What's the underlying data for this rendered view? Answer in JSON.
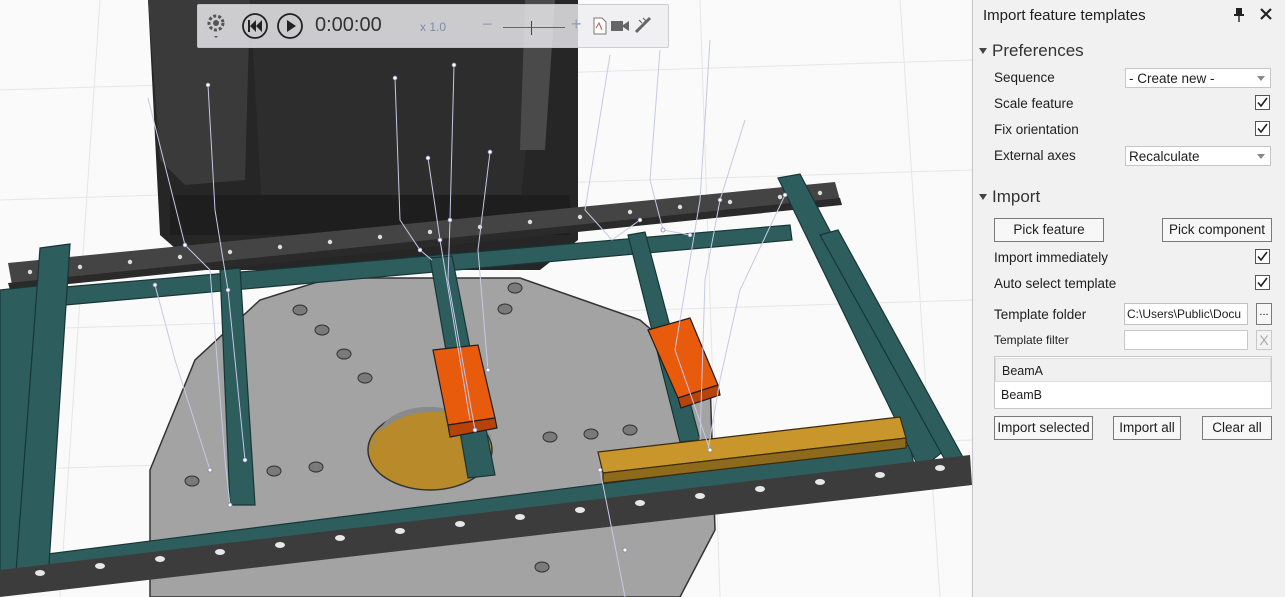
{
  "playback": {
    "time": "0:00:00",
    "speed": "x 1.0",
    "minus": "−",
    "plus": "+"
  },
  "panel": {
    "title": "Import feature templates",
    "preferences": {
      "label": "Preferences",
      "sequence_label": "Sequence",
      "sequence_value": "- Create new -",
      "scale_label": "Scale feature",
      "scale_checked": true,
      "fix_label": "Fix orientation",
      "fix_checked": true,
      "axes_label": "External axes",
      "axes_value": "Recalculate"
    },
    "import": {
      "label": "Import",
      "pick_feature": "Pick feature",
      "pick_component": "Pick component",
      "immediately_label": "Import immediately",
      "immediately_checked": true,
      "autoselect_label": "Auto select template",
      "autoselect_checked": true,
      "folder_label": "Template folder",
      "folder_value": "C:\\Users\\Public\\Docu",
      "browse": "...",
      "filter_label": "Template filter",
      "filter_value": "",
      "clear": "X",
      "templates": [
        "BeamA",
        "BeamB"
      ],
      "import_selected": "Import selected",
      "import_all": "Import all",
      "clear_all": "Clear all"
    }
  },
  "colors": {
    "frame_teal": "#2e5d5d",
    "rail_dark": "#3c3c3c",
    "block_orange": "#e85a0c",
    "beam_gold": "#c9962b",
    "table_gray": "#a3a3a3",
    "machine_black": "#262626"
  }
}
